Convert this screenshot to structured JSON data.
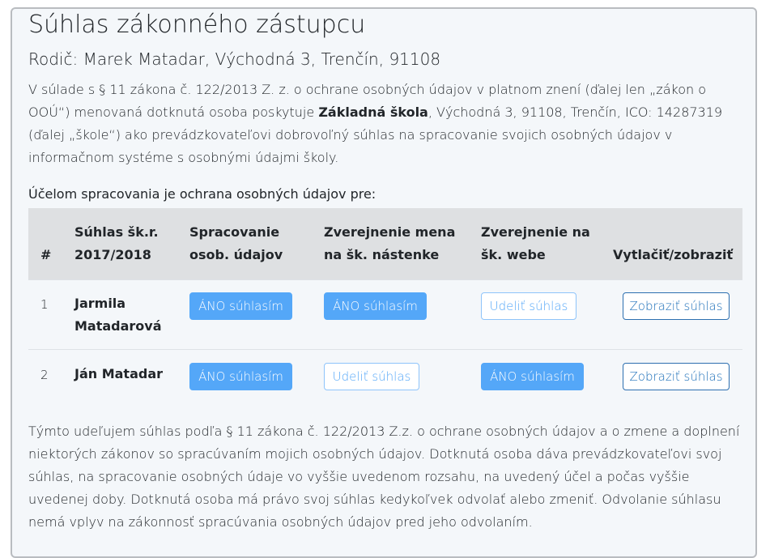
{
  "page": {
    "title": "Súhlas zákonného zástupcu",
    "parent": "Rodič: Marek Matadar, Východná 3, Trenčín, 91108"
  },
  "intro": {
    "before": "V súlade s § 11 zákona č. 122/2013 Z. z. o ochrane osobných údajov v platnom znení (ďalej len „zákon o OOÚ“) menovaná dotknutá osoba poskytuje ",
    "school_name": "Základná škola",
    "after": ", Východná 3, 91108, Trenčín, ICO: 14287319 (ďalej „škole“) ako prevádzkovateľovi dobrovoľný súhlas na spracovanie svojich osobných údajov v informačnom systéme s osobnými údajmi školy."
  },
  "purpose_heading": "Účelom spracovania je ochrana osobných údajov pre:",
  "table": {
    "headers": {
      "num": "#",
      "consent_year_line1": "Súhlas šk.r.",
      "consent_year_line2": "2017/2018",
      "processing_line1": "Spracovanie",
      "processing_line2": "osob. údajov",
      "board_line1": "Zverejnenie mena",
      "board_line2": "na šk. nástenke",
      "web_line1": "Zverejnenie na",
      "web_line2": "šk. webe",
      "print": "Vytlačiť/zobraziť"
    },
    "rows": [
      {
        "num": "1",
        "name_line1": "Jarmila",
        "name_line2": "Matadarová",
        "processing": "ÁNO súhlasím",
        "board": "ÁNO súhlasím",
        "web": "Udeliť súhlas",
        "print": "Zobraziť súhlas"
      },
      {
        "num": "2",
        "name_line1": "Ján Matadar",
        "processing": "ÁNO súhlasím",
        "board": "Udeliť súhlas",
        "web": "ÁNO súhlasím",
        "print": "Zobraziť súhlas"
      }
    ]
  },
  "closing": "Týmto udeľujem súhlas podľa § 11 zákona č. 122/2013 Z.z. o ochrane osobných údajov a o zmene a doplnení niektorých zákonov so spracúvaním mojich osobných údajov. Dotknutá osoba dáva prevádzkovateľovi svoj súhlas, na spracovanie osobných údaje vo vyššie uvedenom rozsahu, na uvedený účel a počas vyššie uvedenej doby. Dotknutá osoba má právo svoj súhlas kedykoľvek odvolať alebo zmeniť. Odvolanie súhlasu nemá vplyv na zákonnosť spracúvania osobných údajov pred jeho odvolaním.",
  "colors": {
    "primary": "#54a7f8",
    "outline_dark": "#1c6fb9",
    "header_bg": "#dee0e2",
    "card_bg": "#f4f7fa"
  }
}
